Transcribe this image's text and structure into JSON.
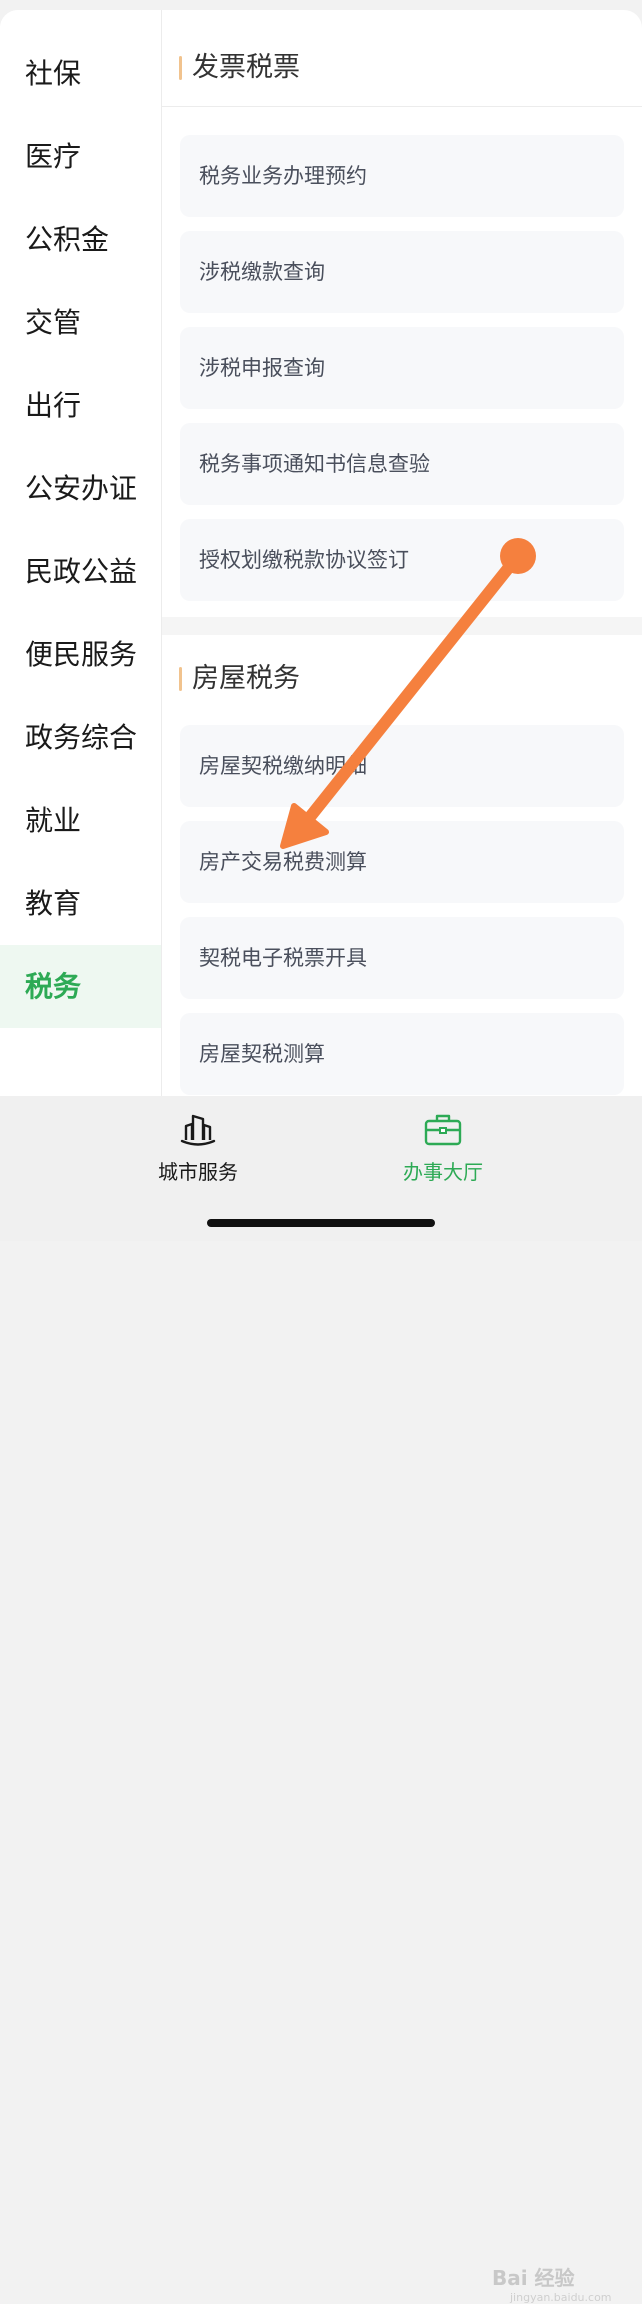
{
  "sidebar": {
    "items": [
      {
        "label": "社保"
      },
      {
        "label": "医疗"
      },
      {
        "label": "公积金"
      },
      {
        "label": "交管"
      },
      {
        "label": "出行"
      },
      {
        "label": "公安办证"
      },
      {
        "label": "民政公益"
      },
      {
        "label": "便民服务"
      },
      {
        "label": "政务综合"
      },
      {
        "label": "就业"
      },
      {
        "label": "教育"
      },
      {
        "label": "税务",
        "active": true
      }
    ]
  },
  "sections": [
    {
      "title": "发票税票",
      "items": [
        "税务业务办理预约",
        "涉税缴款查询",
        "涉税申报查询",
        "税务事项通知书信息查验",
        "授权划缴税款协议签订"
      ]
    },
    {
      "title": "房屋税务",
      "items": [
        "房屋契税缴纳明细",
        "房产交易税费测算",
        "契税电子税票开具",
        "房屋契税测算"
      ]
    }
  ],
  "tabbar": {
    "city_service": {
      "label": "城市服务",
      "icon": "city-buildings-icon"
    },
    "affairs_hall": {
      "label": "办事大厅",
      "icon": "briefcase-icon",
      "active": true
    }
  },
  "watermark": {
    "text": "Bai 经验",
    "url": "jingyan.baidu.com"
  },
  "colors": {
    "accent": "#2daa55",
    "active_bg": "#eef8f1",
    "arrow": "#f5803e",
    "title_bar": "#f1c38e",
    "item_bg": "#f7f8fa"
  }
}
